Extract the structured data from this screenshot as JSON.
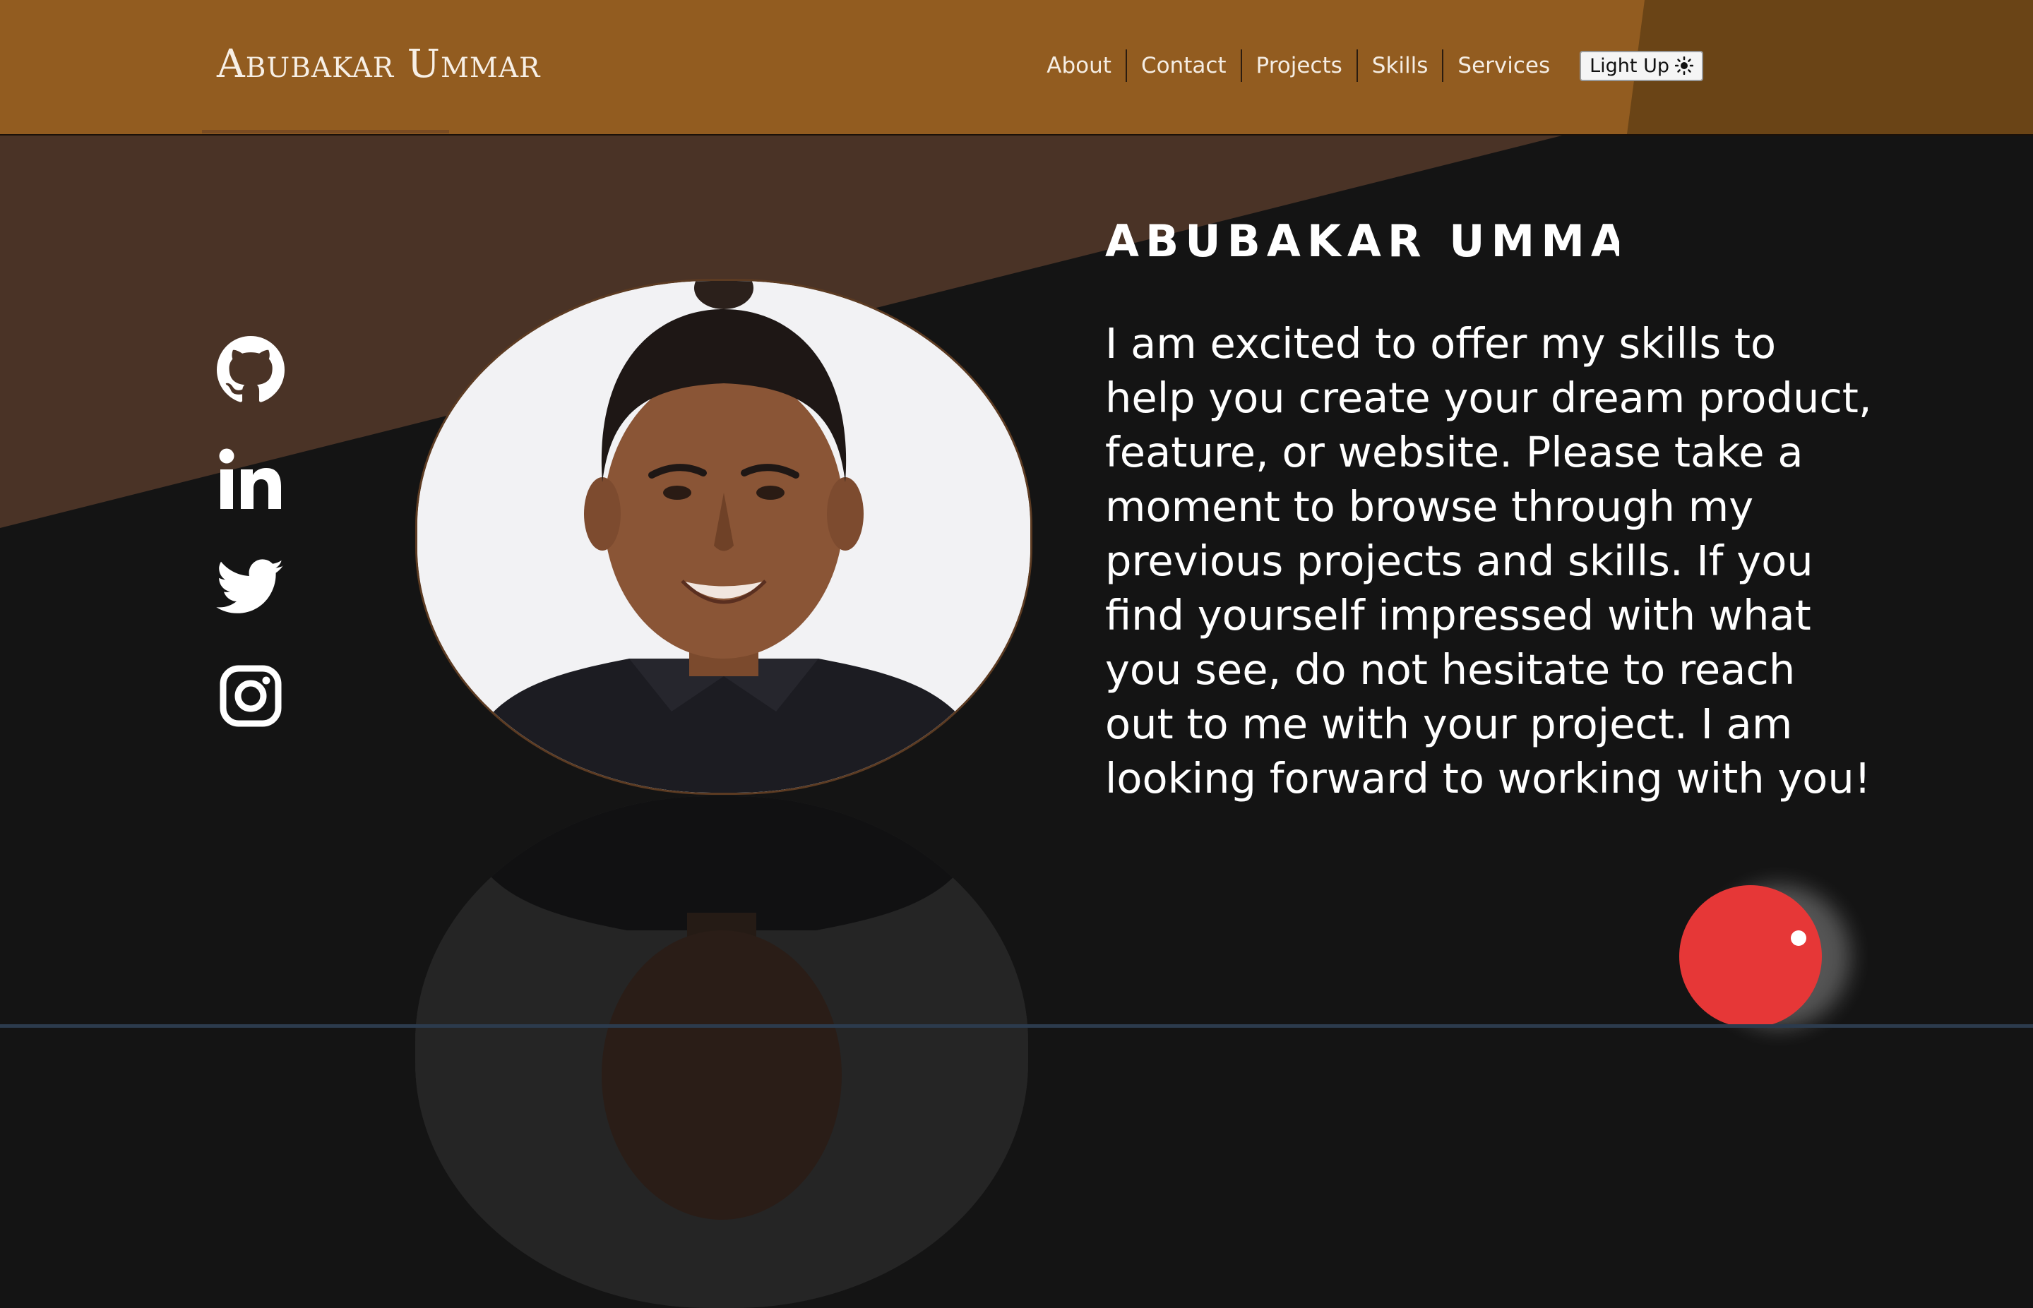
{
  "header": {
    "logo": "Abubakar Ummar",
    "nav": [
      "About",
      "Contact",
      "Projects",
      "Skills",
      "Services"
    ],
    "theme_toggle": {
      "label": "Light Up",
      "icon": "sun-icon"
    }
  },
  "hero": {
    "name": "ABUBAKAR UMMAR",
    "intro": "I am excited to offer my skills to help you create your dream product, feature, or website. Please take a moment to browse through my previous projects and skills. If you find yourself impressed with what you see, do not hesitate to reach out to me with your project. I am looking forward to working with you!",
    "portrait": "profile-photo"
  },
  "socials": [
    "github-icon",
    "linkedin-icon",
    "twitter-icon",
    "instagram-icon"
  ],
  "colors": {
    "header": "#925c20",
    "header_dark": "#6a4416",
    "wedge": "#4a3326",
    "background": "#141414",
    "accent_ball": "#e63737"
  }
}
